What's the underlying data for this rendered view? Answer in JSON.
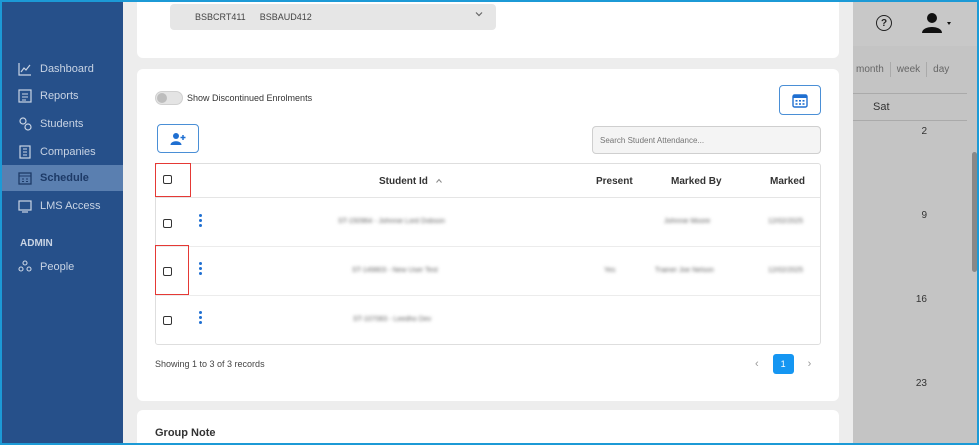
{
  "sidebar": {
    "items": [
      {
        "label": "Dashboard",
        "icon": "chart-line-icon"
      },
      {
        "label": "Reports",
        "icon": "report-icon"
      },
      {
        "label": "Students",
        "icon": "students-icon"
      },
      {
        "label": "Companies",
        "icon": "building-icon"
      },
      {
        "label": "Schedule",
        "icon": "calendar-icon",
        "active": true
      },
      {
        "label": "LMS Access",
        "icon": "lms-icon"
      }
    ],
    "admin_heading": "ADMIN",
    "admin_items": [
      {
        "label": "People",
        "icon": "people-icon"
      }
    ]
  },
  "top_select": {
    "values": [
      "BSBCRT411",
      "BSBAUD412"
    ]
  },
  "toggle": {
    "label": "Show Discontinued Enrolments",
    "on": false
  },
  "search": {
    "placeholder": "Search Student Attendance..."
  },
  "table": {
    "columns": [
      "Student Id",
      "Present",
      "Marked By",
      "Marked"
    ],
    "rows": [
      {
        "student": "ST-150964 - Johnnie Lord Dobson",
        "present": "",
        "marked_by": "Johnnie Moore",
        "marked": "12/02/2025"
      },
      {
        "student": "ST-149803 - New User Test",
        "present": "Yes",
        "marked_by": "Trainer Joe Nelson",
        "marked": "12/02/2025"
      },
      {
        "student": "ST-107083 - Leedho Dev",
        "present": "",
        "marked_by": "",
        "marked": ""
      }
    ]
  },
  "footer": {
    "showing": "Showing 1 to 3 of 3 records",
    "page": "1"
  },
  "group_note": {
    "title": "Group Note"
  },
  "calendar": {
    "views": [
      "month",
      "week",
      "day"
    ],
    "day_header": "Sat",
    "days": [
      "2",
      "9",
      "16",
      "23"
    ]
  },
  "header": {
    "help": "?"
  },
  "colors": {
    "sidebar": "#26508a",
    "accent": "#1596f2",
    "highlight": "#e53935"
  }
}
